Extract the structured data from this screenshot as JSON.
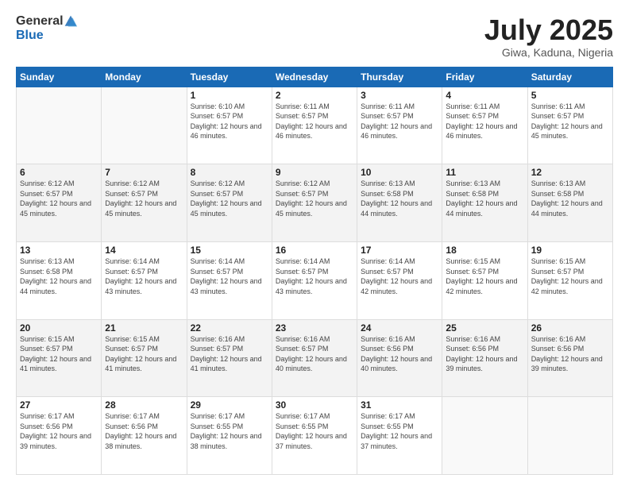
{
  "header": {
    "logo_general": "General",
    "logo_blue": "Blue",
    "month_year": "July 2025",
    "location": "Giwa, Kaduna, Nigeria"
  },
  "weekdays": [
    "Sunday",
    "Monday",
    "Tuesday",
    "Wednesday",
    "Thursday",
    "Friday",
    "Saturday"
  ],
  "weeks": [
    [
      {
        "day": null,
        "info": null
      },
      {
        "day": null,
        "info": null
      },
      {
        "day": "1",
        "info": "Sunrise: 6:10 AM\nSunset: 6:57 PM\nDaylight: 12 hours and 46 minutes."
      },
      {
        "day": "2",
        "info": "Sunrise: 6:11 AM\nSunset: 6:57 PM\nDaylight: 12 hours and 46 minutes."
      },
      {
        "day": "3",
        "info": "Sunrise: 6:11 AM\nSunset: 6:57 PM\nDaylight: 12 hours and 46 minutes."
      },
      {
        "day": "4",
        "info": "Sunrise: 6:11 AM\nSunset: 6:57 PM\nDaylight: 12 hours and 46 minutes."
      },
      {
        "day": "5",
        "info": "Sunrise: 6:11 AM\nSunset: 6:57 PM\nDaylight: 12 hours and 45 minutes."
      }
    ],
    [
      {
        "day": "6",
        "info": "Sunrise: 6:12 AM\nSunset: 6:57 PM\nDaylight: 12 hours and 45 minutes."
      },
      {
        "day": "7",
        "info": "Sunrise: 6:12 AM\nSunset: 6:57 PM\nDaylight: 12 hours and 45 minutes."
      },
      {
        "day": "8",
        "info": "Sunrise: 6:12 AM\nSunset: 6:57 PM\nDaylight: 12 hours and 45 minutes."
      },
      {
        "day": "9",
        "info": "Sunrise: 6:12 AM\nSunset: 6:57 PM\nDaylight: 12 hours and 45 minutes."
      },
      {
        "day": "10",
        "info": "Sunrise: 6:13 AM\nSunset: 6:58 PM\nDaylight: 12 hours and 44 minutes."
      },
      {
        "day": "11",
        "info": "Sunrise: 6:13 AM\nSunset: 6:58 PM\nDaylight: 12 hours and 44 minutes."
      },
      {
        "day": "12",
        "info": "Sunrise: 6:13 AM\nSunset: 6:58 PM\nDaylight: 12 hours and 44 minutes."
      }
    ],
    [
      {
        "day": "13",
        "info": "Sunrise: 6:13 AM\nSunset: 6:58 PM\nDaylight: 12 hours and 44 minutes."
      },
      {
        "day": "14",
        "info": "Sunrise: 6:14 AM\nSunset: 6:57 PM\nDaylight: 12 hours and 43 minutes."
      },
      {
        "day": "15",
        "info": "Sunrise: 6:14 AM\nSunset: 6:57 PM\nDaylight: 12 hours and 43 minutes."
      },
      {
        "day": "16",
        "info": "Sunrise: 6:14 AM\nSunset: 6:57 PM\nDaylight: 12 hours and 43 minutes."
      },
      {
        "day": "17",
        "info": "Sunrise: 6:14 AM\nSunset: 6:57 PM\nDaylight: 12 hours and 42 minutes."
      },
      {
        "day": "18",
        "info": "Sunrise: 6:15 AM\nSunset: 6:57 PM\nDaylight: 12 hours and 42 minutes."
      },
      {
        "day": "19",
        "info": "Sunrise: 6:15 AM\nSunset: 6:57 PM\nDaylight: 12 hours and 42 minutes."
      }
    ],
    [
      {
        "day": "20",
        "info": "Sunrise: 6:15 AM\nSunset: 6:57 PM\nDaylight: 12 hours and 41 minutes."
      },
      {
        "day": "21",
        "info": "Sunrise: 6:15 AM\nSunset: 6:57 PM\nDaylight: 12 hours and 41 minutes."
      },
      {
        "day": "22",
        "info": "Sunrise: 6:16 AM\nSunset: 6:57 PM\nDaylight: 12 hours and 41 minutes."
      },
      {
        "day": "23",
        "info": "Sunrise: 6:16 AM\nSunset: 6:57 PM\nDaylight: 12 hours and 40 minutes."
      },
      {
        "day": "24",
        "info": "Sunrise: 6:16 AM\nSunset: 6:56 PM\nDaylight: 12 hours and 40 minutes."
      },
      {
        "day": "25",
        "info": "Sunrise: 6:16 AM\nSunset: 6:56 PM\nDaylight: 12 hours and 39 minutes."
      },
      {
        "day": "26",
        "info": "Sunrise: 6:16 AM\nSunset: 6:56 PM\nDaylight: 12 hours and 39 minutes."
      }
    ],
    [
      {
        "day": "27",
        "info": "Sunrise: 6:17 AM\nSunset: 6:56 PM\nDaylight: 12 hours and 39 minutes."
      },
      {
        "day": "28",
        "info": "Sunrise: 6:17 AM\nSunset: 6:56 PM\nDaylight: 12 hours and 38 minutes."
      },
      {
        "day": "29",
        "info": "Sunrise: 6:17 AM\nSunset: 6:55 PM\nDaylight: 12 hours and 38 minutes."
      },
      {
        "day": "30",
        "info": "Sunrise: 6:17 AM\nSunset: 6:55 PM\nDaylight: 12 hours and 37 minutes."
      },
      {
        "day": "31",
        "info": "Sunrise: 6:17 AM\nSunset: 6:55 PM\nDaylight: 12 hours and 37 minutes."
      },
      {
        "day": null,
        "info": null
      },
      {
        "day": null,
        "info": null
      }
    ]
  ]
}
